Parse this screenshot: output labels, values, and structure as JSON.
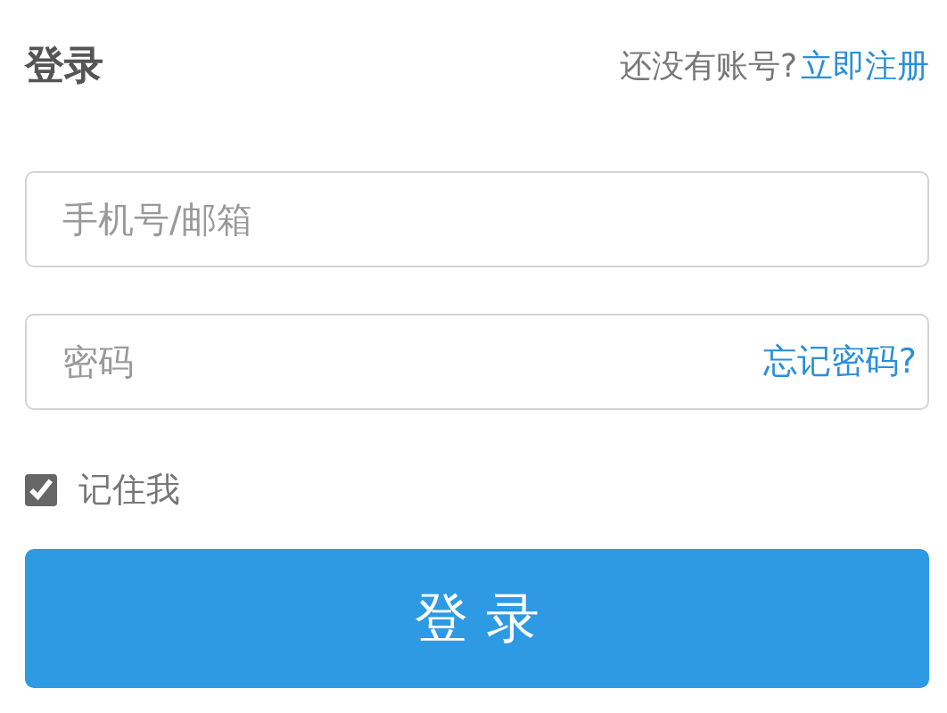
{
  "title": "登录",
  "signup_prompt": "还没有账号?",
  "signup_link": "立即注册",
  "account_field": {
    "placeholder": "手机号/邮箱"
  },
  "password_field": {
    "placeholder": "密码"
  },
  "forgot_link": "忘记密码?",
  "remember": {
    "label": "记住我",
    "checked": true
  },
  "login_button": "登 录"
}
